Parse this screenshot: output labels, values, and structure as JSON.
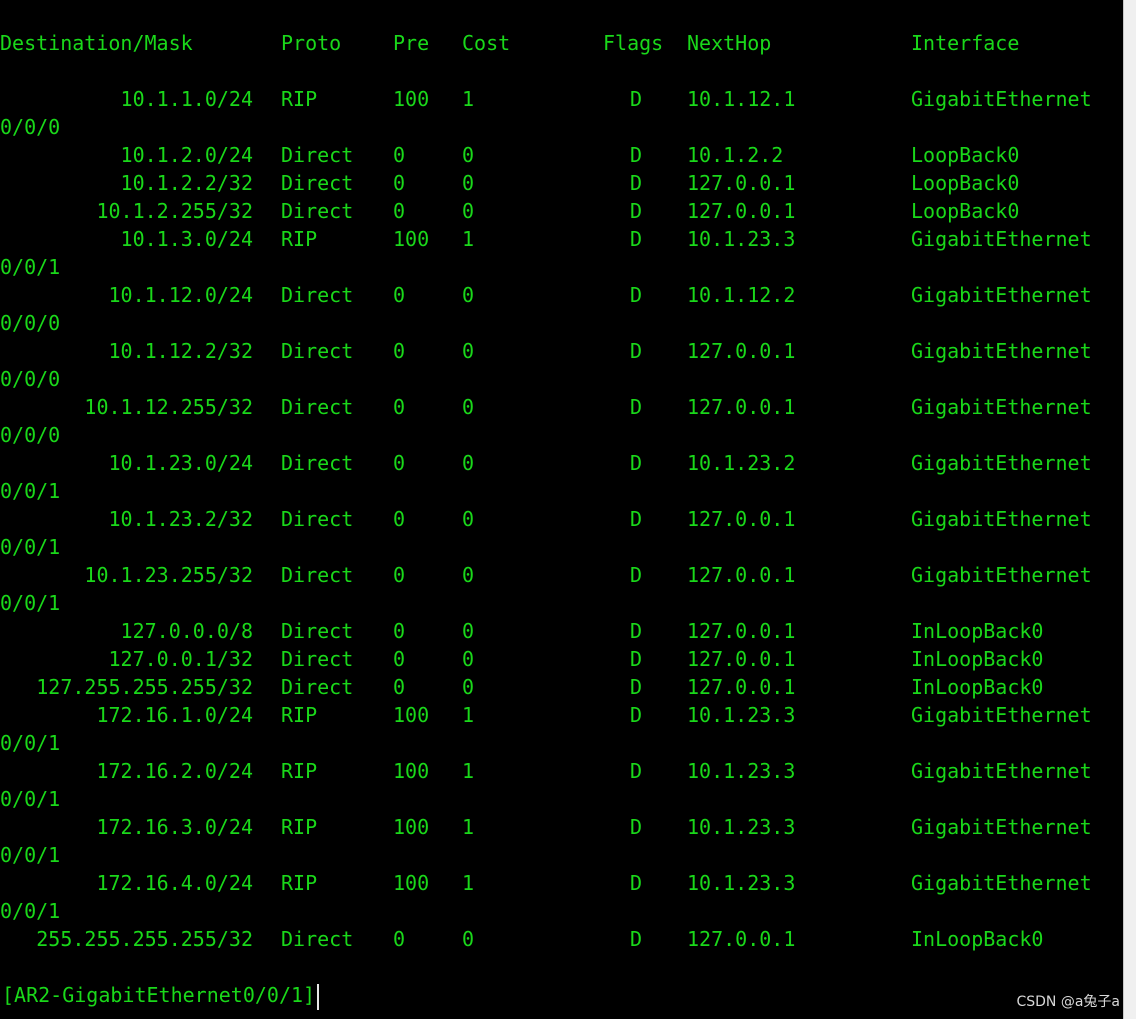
{
  "header": {
    "destination": "Destination/Mask",
    "proto": "Proto",
    "pre": "Pre",
    "cost": "Cost",
    "flags": "Flags",
    "nexthop": "NextHop",
    "interface": "Interface"
  },
  "routes": [
    {
      "dest": "10.1.1.0/24",
      "proto": "RIP",
      "pre": "100",
      "cost": "1",
      "flags": "D",
      "nexthop": "10.1.12.1",
      "iface": "GigabitEthernet",
      "wrap": "0/0/0"
    },
    {
      "dest": "10.1.2.0/24",
      "proto": "Direct",
      "pre": "0",
      "cost": "0",
      "flags": "D",
      "nexthop": "10.1.2.2",
      "iface": "LoopBack0",
      "wrap": ""
    },
    {
      "dest": "10.1.2.2/32",
      "proto": "Direct",
      "pre": "0",
      "cost": "0",
      "flags": "D",
      "nexthop": "127.0.0.1",
      "iface": "LoopBack0",
      "wrap": ""
    },
    {
      "dest": "10.1.2.255/32",
      "proto": "Direct",
      "pre": "0",
      "cost": "0",
      "flags": "D",
      "nexthop": "127.0.0.1",
      "iface": "LoopBack0",
      "wrap": ""
    },
    {
      "dest": "10.1.3.0/24",
      "proto": "RIP",
      "pre": "100",
      "cost": "1",
      "flags": "D",
      "nexthop": "10.1.23.3",
      "iface": "GigabitEthernet",
      "wrap": "0/0/1"
    },
    {
      "dest": "10.1.12.0/24",
      "proto": "Direct",
      "pre": "0",
      "cost": "0",
      "flags": "D",
      "nexthop": "10.1.12.2",
      "iface": "GigabitEthernet",
      "wrap": "0/0/0"
    },
    {
      "dest": "10.1.12.2/32",
      "proto": "Direct",
      "pre": "0",
      "cost": "0",
      "flags": "D",
      "nexthop": "127.0.0.1",
      "iface": "GigabitEthernet",
      "wrap": "0/0/0"
    },
    {
      "dest": "10.1.12.255/32",
      "proto": "Direct",
      "pre": "0",
      "cost": "0",
      "flags": "D",
      "nexthop": "127.0.0.1",
      "iface": "GigabitEthernet",
      "wrap": "0/0/0"
    },
    {
      "dest": "10.1.23.0/24",
      "proto": "Direct",
      "pre": "0",
      "cost": "0",
      "flags": "D",
      "nexthop": "10.1.23.2",
      "iface": "GigabitEthernet",
      "wrap": "0/0/1"
    },
    {
      "dest": "10.1.23.2/32",
      "proto": "Direct",
      "pre": "0",
      "cost": "0",
      "flags": "D",
      "nexthop": "127.0.0.1",
      "iface": "GigabitEthernet",
      "wrap": "0/0/1"
    },
    {
      "dest": "10.1.23.255/32",
      "proto": "Direct",
      "pre": "0",
      "cost": "0",
      "flags": "D",
      "nexthop": "127.0.0.1",
      "iface": "GigabitEthernet",
      "wrap": "0/0/1"
    },
    {
      "dest": "127.0.0.0/8",
      "proto": "Direct",
      "pre": "0",
      "cost": "0",
      "flags": "D",
      "nexthop": "127.0.0.1",
      "iface": "InLoopBack0",
      "wrap": ""
    },
    {
      "dest": "127.0.0.1/32",
      "proto": "Direct",
      "pre": "0",
      "cost": "0",
      "flags": "D",
      "nexthop": "127.0.0.1",
      "iface": "InLoopBack0",
      "wrap": ""
    },
    {
      "dest": "127.255.255.255/32",
      "proto": "Direct",
      "pre": "0",
      "cost": "0",
      "flags": "D",
      "nexthop": "127.0.0.1",
      "iface": "InLoopBack0",
      "wrap": ""
    },
    {
      "dest": "172.16.1.0/24",
      "proto": "RIP",
      "pre": "100",
      "cost": "1",
      "flags": "D",
      "nexthop": "10.1.23.3",
      "iface": "GigabitEthernet",
      "wrap": "0/0/1"
    },
    {
      "dest": "172.16.2.0/24",
      "proto": "RIP",
      "pre": "100",
      "cost": "1",
      "flags": "D",
      "nexthop": "10.1.23.3",
      "iface": "GigabitEthernet",
      "wrap": "0/0/1"
    },
    {
      "dest": "172.16.3.0/24",
      "proto": "RIP",
      "pre": "100",
      "cost": "1",
      "flags": "D",
      "nexthop": "10.1.23.3",
      "iface": "GigabitEthernet",
      "wrap": "0/0/1"
    },
    {
      "dest": "172.16.4.0/24",
      "proto": "RIP",
      "pre": "100",
      "cost": "1",
      "flags": "D",
      "nexthop": "10.1.23.3",
      "iface": "GigabitEthernet",
      "wrap": "0/0/1"
    },
    {
      "dest": "255.255.255.255/32",
      "proto": "Direct",
      "pre": "0",
      "cost": "0",
      "flags": "D",
      "nexthop": "127.0.0.1",
      "iface": "InLoopBack0",
      "wrap": ""
    }
  ],
  "prompt": "[AR2-GigabitEthernet0/0/1]",
  "watermark": "CSDN @a兔子a"
}
